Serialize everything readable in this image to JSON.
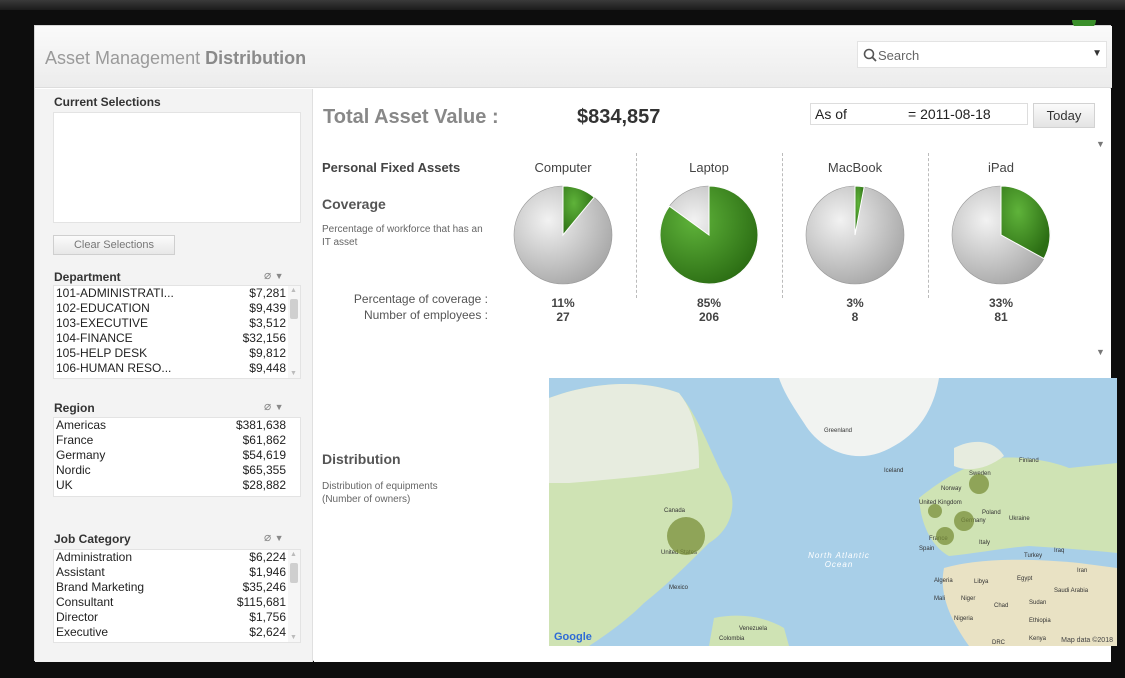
{
  "app": {
    "title_light": "Asset Management",
    "title_bold": "Distribution",
    "search_placeholder": "Search"
  },
  "sidebar": {
    "current_selections_title": "Current Selections",
    "clear_button": "Clear Selections",
    "department": {
      "title": "Department",
      "rows": [
        {
          "name": "101-ADMINISTRATI...",
          "value": "$7,281"
        },
        {
          "name": "102-EDUCATION",
          "value": "$9,439"
        },
        {
          "name": "103-EXECUTIVE",
          "value": "$3,512"
        },
        {
          "name": "104-FINANCE",
          "value": "$32,156"
        },
        {
          "name": "105-HELP DESK",
          "value": "$9,812"
        },
        {
          "name": "106-HUMAN RESO...",
          "value": "$9,448"
        }
      ]
    },
    "region": {
      "title": "Region",
      "rows": [
        {
          "name": "Americas",
          "value": "$381,638"
        },
        {
          "name": "France",
          "value": "$61,862"
        },
        {
          "name": "Germany",
          "value": "$54,619"
        },
        {
          "name": "Nordic",
          "value": "$65,355"
        },
        {
          "name": "UK",
          "value": "$28,882"
        }
      ]
    },
    "job_category": {
      "title": "Job Category",
      "rows": [
        {
          "name": "Administration",
          "value": "$6,224"
        },
        {
          "name": "Assistant",
          "value": "$1,946"
        },
        {
          "name": "Brand Marketing",
          "value": "$35,246"
        },
        {
          "name": "Consultant",
          "value": "$115,681"
        },
        {
          "name": "Director",
          "value": "$1,756"
        },
        {
          "name": "Executive",
          "value": "$2,624"
        }
      ]
    }
  },
  "main": {
    "total_label": "Total Asset Value :",
    "total_value": "$834,857",
    "as_of_label": "As of",
    "as_of_value": "= 2011-08-18",
    "today_button": "Today",
    "personal_fixed_assets": "Personal Fixed Assets",
    "coverage_title": "Coverage",
    "coverage_desc": "Percentage of workforce that has an IT asset",
    "pct_coverage_label": "Percentage of coverage :",
    "num_employees_label": "Number of employees :",
    "distribution_title": "Distribution",
    "distribution_desc": "Distribution of equipments (Number of owners)"
  },
  "chart_data": {
    "type": "pie",
    "charts": [
      {
        "category": "Computer",
        "coverage_pct": 11,
        "coverage_text": "11%",
        "employees": "27"
      },
      {
        "category": "Laptop",
        "coverage_pct": 85,
        "coverage_text": "85%",
        "employees": "206"
      },
      {
        "category": "MacBook",
        "coverage_pct": 3,
        "coverage_text": "3%",
        "employees": "8"
      },
      {
        "category": "iPad",
        "coverage_pct": 33,
        "coverage_text": "33%",
        "employees": "81"
      }
    ],
    "colors": {
      "covered": "#3f8f22",
      "uncovered": "#cfcfcf"
    }
  },
  "map": {
    "labels": [
      "Greenland",
      "Iceland",
      "Sweden",
      "Norway",
      "Finland",
      "United Kingdom",
      "Poland",
      "Germany",
      "Ukraine",
      "France",
      "Italy",
      "Spain",
      "Turkey",
      "Iraq",
      "Iran",
      "Canada",
      "United States",
      "Mexico",
      "Algeria",
      "Libya",
      "Egypt",
      "Saudi Arabia",
      "Mali",
      "Niger",
      "Chad",
      "Sudan",
      "Nigeria",
      "Ethiopia",
      "Venezuela",
      "Colombia",
      "DRC",
      "Kenya"
    ],
    "ocean_label": "North Atlantic Ocean",
    "attribution_logo": "Google",
    "attribution_text": "Map data ©2018",
    "bubble_color": "#7a8f3a"
  }
}
